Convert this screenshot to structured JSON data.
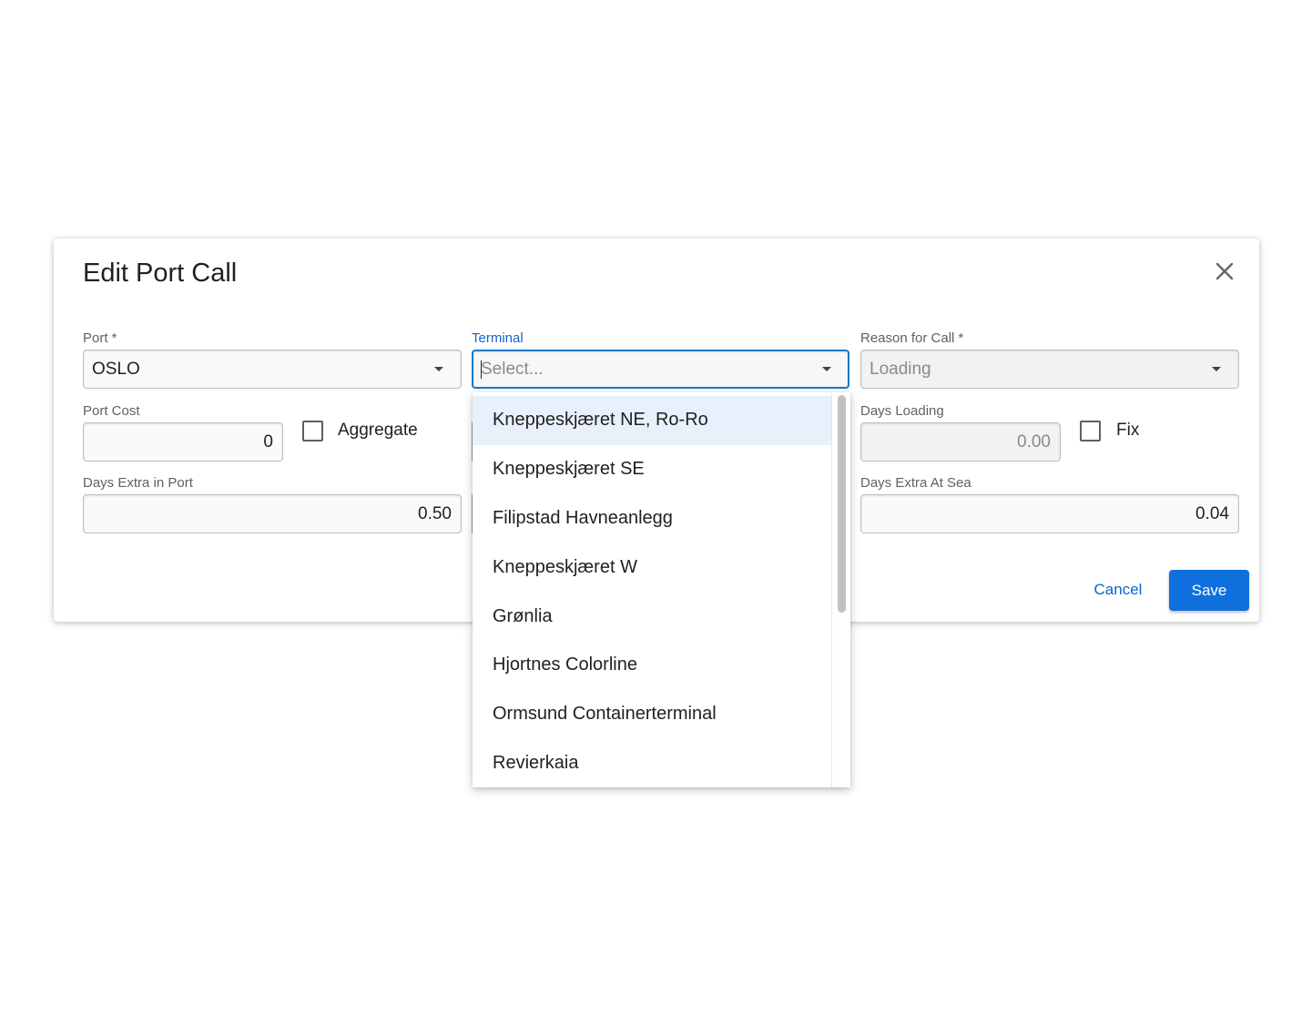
{
  "dialog": {
    "title": "Edit Port Call",
    "close_icon": "close-icon"
  },
  "port": {
    "label": "Port *",
    "value": "OSLO"
  },
  "terminal": {
    "label": "Terminal",
    "placeholder": "Select...",
    "options": [
      "Kneppeskjæret NE, Ro-Ro",
      "Kneppeskjæret SE",
      "Filipstad Havneanlegg",
      "Kneppeskjæret W",
      "Grønlia",
      "Hjortnes Colorline",
      "Ormsund Containerterminal",
      "Revierkaia"
    ],
    "highlighted_index": 0
  },
  "reason": {
    "label": "Reason for Call *",
    "value": "Loading"
  },
  "port_cost": {
    "label": "Port Cost",
    "value": "0"
  },
  "aggregate": {
    "label": "Aggregate",
    "checked": false
  },
  "days_loading": {
    "label": "Days Loading",
    "value": "0.00"
  },
  "fix": {
    "label": "Fix",
    "checked": false
  },
  "days_extra_port": {
    "label": "Days Extra in Port",
    "value": "0.50"
  },
  "days_extra_sea": {
    "label": "Days Extra At Sea",
    "value": "0.04"
  },
  "actions": {
    "cancel_label": "Cancel",
    "save_label": "Save"
  },
  "colors": {
    "accent": "#0f6fdc",
    "focus": "#1e78c8",
    "highlight": "#e8f0fb"
  }
}
